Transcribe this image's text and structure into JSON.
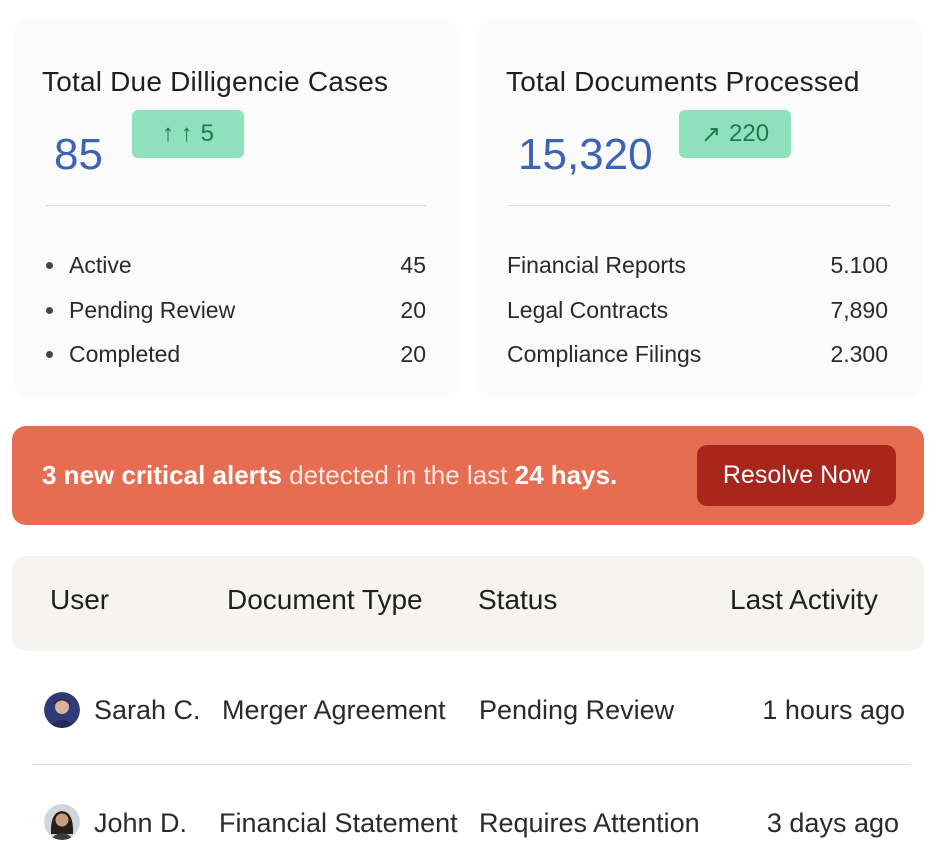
{
  "cases_card": {
    "title": "Total Due Dilligencie Cases",
    "total": "85",
    "delta_icon": "double-up-arrow-icon",
    "delta_arrows": "↑ ↑",
    "delta_value": "5",
    "items": [
      {
        "label": "Active",
        "value": "45"
      },
      {
        "label": "Pending Review",
        "value": "20"
      },
      {
        "label": "Completed",
        "value": "20"
      }
    ]
  },
  "docs_card": {
    "title": "Total Documents Processed",
    "total": "15,320",
    "delta_icon": "trend-up-arrow-icon",
    "delta_arrow": "↗",
    "delta_value": "220",
    "items": [
      {
        "label": "Financial Reports",
        "value": "5.100"
      },
      {
        "label": "Legal Contracts",
        "value": "7,890"
      },
      {
        "label": "Compliance Filings",
        "value": "2.300"
      }
    ]
  },
  "alert": {
    "count_text": "3 new critical alerts",
    "middle_text": " detected in the last ",
    "period_text": "24 hays.",
    "button_label": "Resolve Now"
  },
  "table": {
    "headers": [
      "User",
      "Document Type",
      "Status",
      "Last Activity"
    ],
    "rows": [
      {
        "avatar": "avatar-male-icon",
        "user": "Sarah C.",
        "doc_type": "Merger Agreement",
        "status": "Pending Review",
        "last_activity": "1 hours ago"
      },
      {
        "avatar": "avatar-female-icon",
        "user": "John D.",
        "doc_type": "Financial Statement",
        "status": "Requires Attention",
        "last_activity": "3 days ago"
      }
    ]
  },
  "colors": {
    "accent_number": "#3a64b4",
    "delta_bg": "#8fe0bc",
    "alert_bg": "#e66d51",
    "alert_button": "#a9261d"
  }
}
